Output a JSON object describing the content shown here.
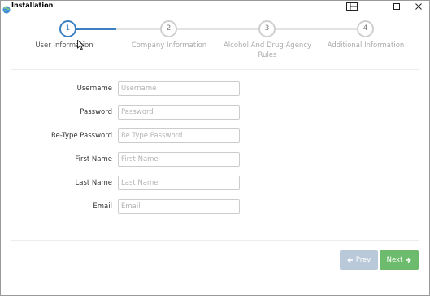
{
  "window": {
    "title": "Installation"
  },
  "stepper": {
    "steps": [
      {
        "number": "1",
        "label": "User Information",
        "active": true
      },
      {
        "number": "2",
        "label": "Company Information",
        "active": false
      },
      {
        "number": "3",
        "label": "Alcohol And Drug Agency Rules",
        "active": false
      },
      {
        "number": "4",
        "label": "Additional Information",
        "active": false
      }
    ]
  },
  "form": {
    "fields": [
      {
        "label": "Username",
        "placeholder": "Username",
        "value": ""
      },
      {
        "label": "Password",
        "placeholder": "Password",
        "value": ""
      },
      {
        "label": "Re-Type Password",
        "placeholder": "Re Type Password",
        "value": ""
      },
      {
        "label": "First Name",
        "placeholder": "First Name",
        "value": ""
      },
      {
        "label": "Last Name",
        "placeholder": "Last Name",
        "value": ""
      },
      {
        "label": "Email",
        "placeholder": "Email",
        "value": ""
      }
    ]
  },
  "buttons": {
    "prev_label": "Prev",
    "next_label": "Next",
    "prev_disabled": true
  },
  "colors": {
    "accent": "#3a7fc1",
    "next_button": "#6dbb6d",
    "prev_button_disabled": "#b9c9d9"
  },
  "icons": {
    "app": "app-globe-icon",
    "layout": "layout-icon",
    "minimize": "minimize-icon",
    "maximize": "maximize-icon",
    "close": "close-icon",
    "prev": "arrow-left-icon",
    "next": "arrow-right-icon"
  }
}
